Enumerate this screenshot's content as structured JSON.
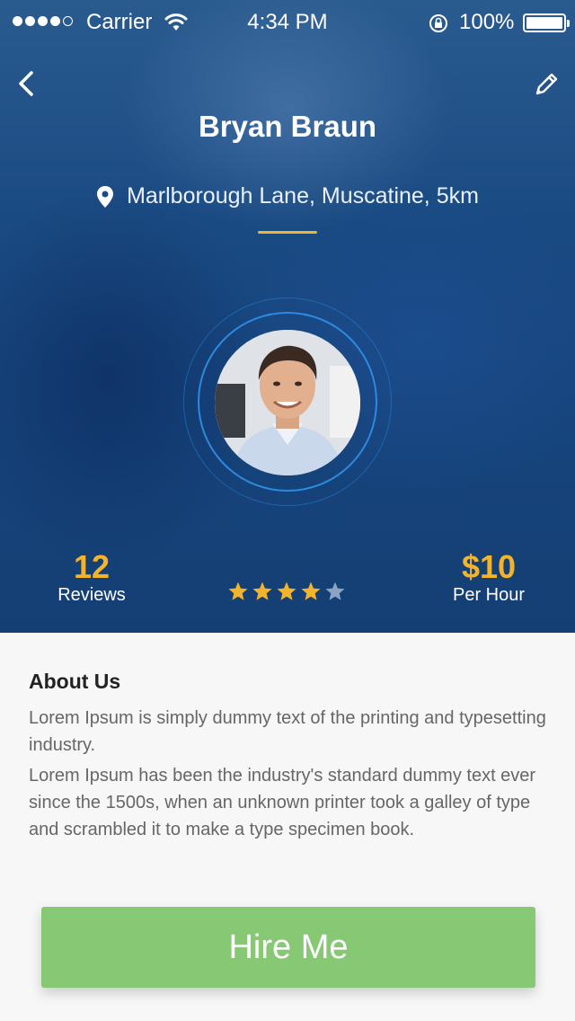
{
  "status_bar": {
    "carrier": "Carrier",
    "time": "4:34 PM",
    "battery_percent": "100%",
    "signal_bars": 4
  },
  "profile": {
    "name": "Bryan Braun",
    "location": "Marlborough Lane, Muscatine, 5km"
  },
  "stats": {
    "reviews_count": "12",
    "reviews_label": "Reviews",
    "rating": 4,
    "rating_max": 5,
    "price": "$10",
    "price_label": "Per Hour"
  },
  "about": {
    "title": "About Us",
    "paragraph1": "Lorem Ipsum is simply dummy text of the printing and typesetting industry.",
    "paragraph2": "Lorem Ipsum has been the industry's standard dummy text ever since the 1500s, when an unknown printer took a galley of type and scrambled it to make a type specimen book."
  },
  "actions": {
    "hire_label": "Hire Me"
  },
  "icons": {
    "back": "chevron-left-icon",
    "edit": "pencil-icon",
    "location": "map-pin-icon",
    "star": "star-icon"
  },
  "colors": {
    "accent": "#f4b42a",
    "hire_button": "#86c873",
    "star_empty": "#8aa4c4"
  }
}
